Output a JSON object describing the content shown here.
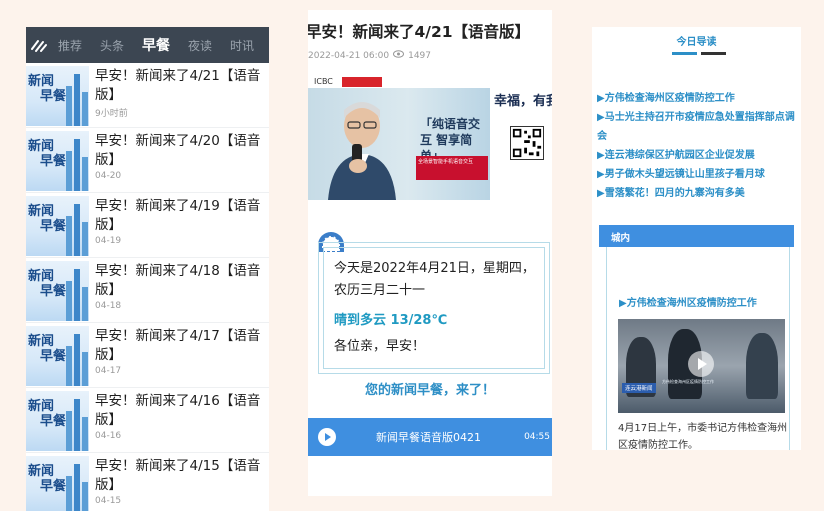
{
  "list_panel": {
    "tabs": [
      {
        "label": "推荐"
      },
      {
        "label": "头条"
      },
      {
        "label": "早餐"
      },
      {
        "label": "夜读"
      },
      {
        "label": "时讯"
      }
    ],
    "thumb_text_1": "新闻",
    "thumb_text_2": "早餐",
    "items": [
      {
        "title": "早安！新闻来了4/21【语音版】",
        "date": "9小时前"
      },
      {
        "title": "早安！新闻来了4/20【语音版】",
        "date": "04-20"
      },
      {
        "title": "早安！新闻来了4/19【语音版】",
        "date": "04-19"
      },
      {
        "title": "早安！新闻来了4/18【语音版】",
        "date": "04-18"
      },
      {
        "title": "早安！新闻来了4/17【语音版】",
        "date": "04-17"
      },
      {
        "title": "早安！新闻来了4/16【语音版】",
        "date": "04-16"
      },
      {
        "title": "早安！新闻来了4/15【语音版】",
        "date": "04-15"
      }
    ]
  },
  "article_panel": {
    "title": "早安！新闻来了4/21【语音版】",
    "datetime": "2022-04-21 06:00",
    "views": "1497",
    "ad": {
      "bank_logo": "ICBC",
      "slogan": "「纯语音交互 智享简单」",
      "happy": "幸福，有我",
      "sub": "全场景智能手机语音交互"
    },
    "greeting_line1": "今天是2022年4月21日，星期四，农历三月二十一",
    "weather": "晴到多云  13/28℃",
    "hello": "各位亲，早安！",
    "slogan": "您的新闻早餐，来了！",
    "player": {
      "title": "新闻早餐语音版0421",
      "time": "04:55"
    }
  },
  "guide_panel": {
    "header": "今日导读",
    "links": [
      "▶方伟检查海州区疫情防控工作",
      "▶马士光主持召开市疫情应急处置指挥部点调会",
      "▶连云港综保区护航园区企业促发展",
      "▶男子做木头望远镜让山里孩子看月球",
      "▶雪落繁花！四月的九寨沟有多美"
    ],
    "section": "城内",
    "news_title": "▶方伟检查海州区疫情防控工作",
    "video_label": "连云港新闻",
    "video_sub": "方伟检查海州区疫情防控工作",
    "desc": "4月17日上午，市委书记方伟检查海州区疫情防控工作。"
  }
}
